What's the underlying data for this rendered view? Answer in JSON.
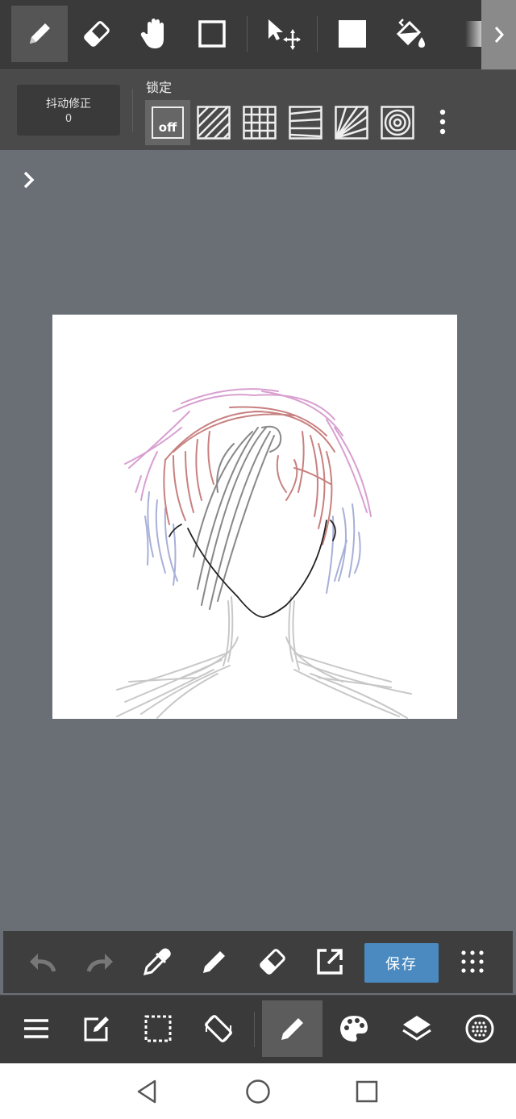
{
  "top_toolbar": {
    "tools": [
      {
        "name": "pen",
        "icon": "pen-icon",
        "active": true
      },
      {
        "name": "eraser",
        "icon": "eraser-icon"
      },
      {
        "name": "hand",
        "icon": "hand-icon"
      },
      {
        "name": "rectangle",
        "icon": "rectangle-icon"
      },
      {
        "name": "move",
        "icon": "move-icon"
      },
      {
        "name": "fill-color",
        "icon": "square-fill-icon"
      },
      {
        "name": "bucket",
        "icon": "bucket-icon"
      },
      {
        "name": "gradient",
        "icon": "gradient-icon"
      }
    ],
    "more_icon": "chevron-right-icon"
  },
  "sub_toolbar": {
    "stabilizer_label": "抖动修正",
    "stabilizer_value": "0",
    "lock_label": "锁定",
    "off_label": "off",
    "rulers": [
      "parallel-ruler-icon",
      "grid-ruler-icon",
      "perspective-ruler-icon",
      "radial-ruler-icon",
      "concentric-ruler-icon"
    ],
    "more_icon": "kebab-icon"
  },
  "action_bar": {
    "buttons": [
      "undo-icon",
      "redo-icon",
      "eyedropper-icon",
      "pen-icon",
      "eraser-icon",
      "export-icon"
    ],
    "save_label": "保存",
    "grid_icon": "grid-dots-icon"
  },
  "bottom_nav": {
    "items": [
      "menu-icon",
      "edit-icon",
      "selection-icon",
      "rotate-icon",
      "brush-icon",
      "palette-icon",
      "layers-icon",
      "material-icon"
    ],
    "active_item": "brush-icon"
  },
  "system_nav": [
    "back-icon",
    "home-icon",
    "recent-apps-icon"
  ],
  "colors": {
    "toolbar_bg": "#3a3a3a",
    "workspace_bg": "#6a6e75",
    "accent": "#4a8ac0",
    "canvas": "#ffffff"
  }
}
